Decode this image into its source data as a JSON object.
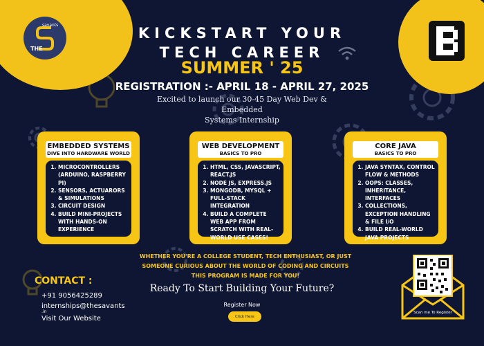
{
  "headline": {
    "line1": "KICKSTART YOUR",
    "line2": "TECH CAREER",
    "season": "SUMMER ' 25",
    "registration": "REGISTRATION :- APRIL 18 - APRIL 27, 2025",
    "description_line1": "Excited to launch our 30-45 Day Web Dev & Embedded",
    "description_line2": "Systems Internship"
  },
  "logo_left": {
    "the": "THE",
    "savants": "savants"
  },
  "cards": [
    {
      "title": "EMBEDDED SYSTEMS",
      "subtitle": "DIVE INTO HARDWARE WORLD",
      "items": [
        "MICROCONTROLLERS (ARDUINO, RASPBERRY PI)",
        "SENSORS, ACTUARORS & SIMULATIONS",
        "CIRCUIT DESIGN",
        "BUILD MINI-PROJECTS WITH HANDS-ON EXPERIENCE"
      ]
    },
    {
      "title": "WEB DEVELOPMENT",
      "subtitle": "BASICS TO PRO",
      "items": [
        "HTML, CSS, JAVASCRIPT, REACT.JS",
        "NODE JS, EXPRESS.JS",
        "MONGODB, MYSQL + FULL-STACK INTEGRATION",
        "BUILD A COMPLETE WEB APP FROM SCRATCH WITH REAL-WORLD USE CASES!"
      ]
    },
    {
      "title": "CORE JAVA",
      "subtitle": "BASICS TO PRO",
      "items": [
        "JAVA SYNTAX, CONTROL FLOW & METHODS",
        "OOPS: CLASSES, INHERITANCE, INTERFACES",
        "COLLECTIONS, EXCEPTION HANDLING & FILE I/O",
        "BUILD REAL-WORLD JAVA PROJECTS"
      ]
    }
  ],
  "tagline": {
    "line1": "WHETHER YOU'RE A COLLEGE STUDENT, TECH ENTHUSIAST, OR JUST",
    "line2": "SOMEONE CURIOUS ABOUT THE WORLD OF CODING AND CIRCUITS",
    "line3": "THIS PROGRAM IS MADE FOR YOU!"
  },
  "cta": {
    "ready": "Ready To Start Building Your Future?",
    "register_now": "Register Now",
    "click_here": "Click Here"
  },
  "contact": {
    "title": "CONTACT :",
    "phone": "+91 9056425289",
    "email": "internships@thesavants",
    "email_suffix": ".in",
    "website": "Visit Our Website"
  },
  "qr": {
    "caption": "Scan me To Register"
  },
  "colors": {
    "background": "#0e1633",
    "accent_yellow": "#f7c516",
    "text": "#ffffff",
    "logo_mark": "#2c3a6b"
  },
  "icons": {
    "logo_left": "the-savants-logo",
    "logo_right": "b-logo-icon",
    "wifi": "wifi-icon",
    "gears": "gear-icon",
    "bulb": "lightbulb-icon",
    "qr": "qr-code-icon"
  }
}
